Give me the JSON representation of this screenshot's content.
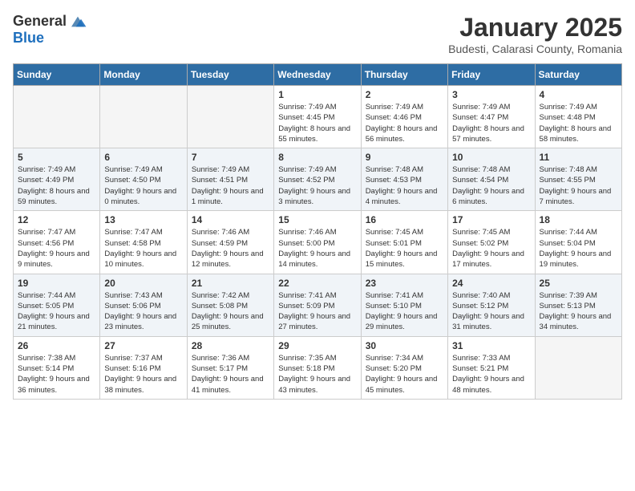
{
  "header": {
    "logo_general": "General",
    "logo_blue": "Blue",
    "month_title": "January 2025",
    "location": "Budesti, Calarasi County, Romania"
  },
  "weekdays": [
    "Sunday",
    "Monday",
    "Tuesday",
    "Wednesday",
    "Thursday",
    "Friday",
    "Saturday"
  ],
  "weeks": [
    [
      {
        "day": "",
        "empty": true
      },
      {
        "day": "",
        "empty": true
      },
      {
        "day": "",
        "empty": true
      },
      {
        "day": "1",
        "sunrise": "7:49 AM",
        "sunset": "4:45 PM",
        "daylight": "8 hours and 55 minutes."
      },
      {
        "day": "2",
        "sunrise": "7:49 AM",
        "sunset": "4:46 PM",
        "daylight": "8 hours and 56 minutes."
      },
      {
        "day": "3",
        "sunrise": "7:49 AM",
        "sunset": "4:47 PM",
        "daylight": "8 hours and 57 minutes."
      },
      {
        "day": "4",
        "sunrise": "7:49 AM",
        "sunset": "4:48 PM",
        "daylight": "8 hours and 58 minutes."
      }
    ],
    [
      {
        "day": "5",
        "sunrise": "7:49 AM",
        "sunset": "4:49 PM",
        "daylight": "8 hours and 59 minutes."
      },
      {
        "day": "6",
        "sunrise": "7:49 AM",
        "sunset": "4:50 PM",
        "daylight": "9 hours and 0 minutes."
      },
      {
        "day": "7",
        "sunrise": "7:49 AM",
        "sunset": "4:51 PM",
        "daylight": "9 hours and 1 minute."
      },
      {
        "day": "8",
        "sunrise": "7:49 AM",
        "sunset": "4:52 PM",
        "daylight": "9 hours and 3 minutes."
      },
      {
        "day": "9",
        "sunrise": "7:48 AM",
        "sunset": "4:53 PM",
        "daylight": "9 hours and 4 minutes."
      },
      {
        "day": "10",
        "sunrise": "7:48 AM",
        "sunset": "4:54 PM",
        "daylight": "9 hours and 6 minutes."
      },
      {
        "day": "11",
        "sunrise": "7:48 AM",
        "sunset": "4:55 PM",
        "daylight": "9 hours and 7 minutes."
      }
    ],
    [
      {
        "day": "12",
        "sunrise": "7:47 AM",
        "sunset": "4:56 PM",
        "daylight": "9 hours and 9 minutes."
      },
      {
        "day": "13",
        "sunrise": "7:47 AM",
        "sunset": "4:58 PM",
        "daylight": "9 hours and 10 minutes."
      },
      {
        "day": "14",
        "sunrise": "7:46 AM",
        "sunset": "4:59 PM",
        "daylight": "9 hours and 12 minutes."
      },
      {
        "day": "15",
        "sunrise": "7:46 AM",
        "sunset": "5:00 PM",
        "daylight": "9 hours and 14 minutes."
      },
      {
        "day": "16",
        "sunrise": "7:45 AM",
        "sunset": "5:01 PM",
        "daylight": "9 hours and 15 minutes."
      },
      {
        "day": "17",
        "sunrise": "7:45 AM",
        "sunset": "5:02 PM",
        "daylight": "9 hours and 17 minutes."
      },
      {
        "day": "18",
        "sunrise": "7:44 AM",
        "sunset": "5:04 PM",
        "daylight": "9 hours and 19 minutes."
      }
    ],
    [
      {
        "day": "19",
        "sunrise": "7:44 AM",
        "sunset": "5:05 PM",
        "daylight": "9 hours and 21 minutes."
      },
      {
        "day": "20",
        "sunrise": "7:43 AM",
        "sunset": "5:06 PM",
        "daylight": "9 hours and 23 minutes."
      },
      {
        "day": "21",
        "sunrise": "7:42 AM",
        "sunset": "5:08 PM",
        "daylight": "9 hours and 25 minutes."
      },
      {
        "day": "22",
        "sunrise": "7:41 AM",
        "sunset": "5:09 PM",
        "daylight": "9 hours and 27 minutes."
      },
      {
        "day": "23",
        "sunrise": "7:41 AM",
        "sunset": "5:10 PM",
        "daylight": "9 hours and 29 minutes."
      },
      {
        "day": "24",
        "sunrise": "7:40 AM",
        "sunset": "5:12 PM",
        "daylight": "9 hours and 31 minutes."
      },
      {
        "day": "25",
        "sunrise": "7:39 AM",
        "sunset": "5:13 PM",
        "daylight": "9 hours and 34 minutes."
      }
    ],
    [
      {
        "day": "26",
        "sunrise": "7:38 AM",
        "sunset": "5:14 PM",
        "daylight": "9 hours and 36 minutes."
      },
      {
        "day": "27",
        "sunrise": "7:37 AM",
        "sunset": "5:16 PM",
        "daylight": "9 hours and 38 minutes."
      },
      {
        "day": "28",
        "sunrise": "7:36 AM",
        "sunset": "5:17 PM",
        "daylight": "9 hours and 41 minutes."
      },
      {
        "day": "29",
        "sunrise": "7:35 AM",
        "sunset": "5:18 PM",
        "daylight": "9 hours and 43 minutes."
      },
      {
        "day": "30",
        "sunrise": "7:34 AM",
        "sunset": "5:20 PM",
        "daylight": "9 hours and 45 minutes."
      },
      {
        "day": "31",
        "sunrise": "7:33 AM",
        "sunset": "5:21 PM",
        "daylight": "9 hours and 48 minutes."
      },
      {
        "day": "",
        "empty": true
      }
    ]
  ]
}
